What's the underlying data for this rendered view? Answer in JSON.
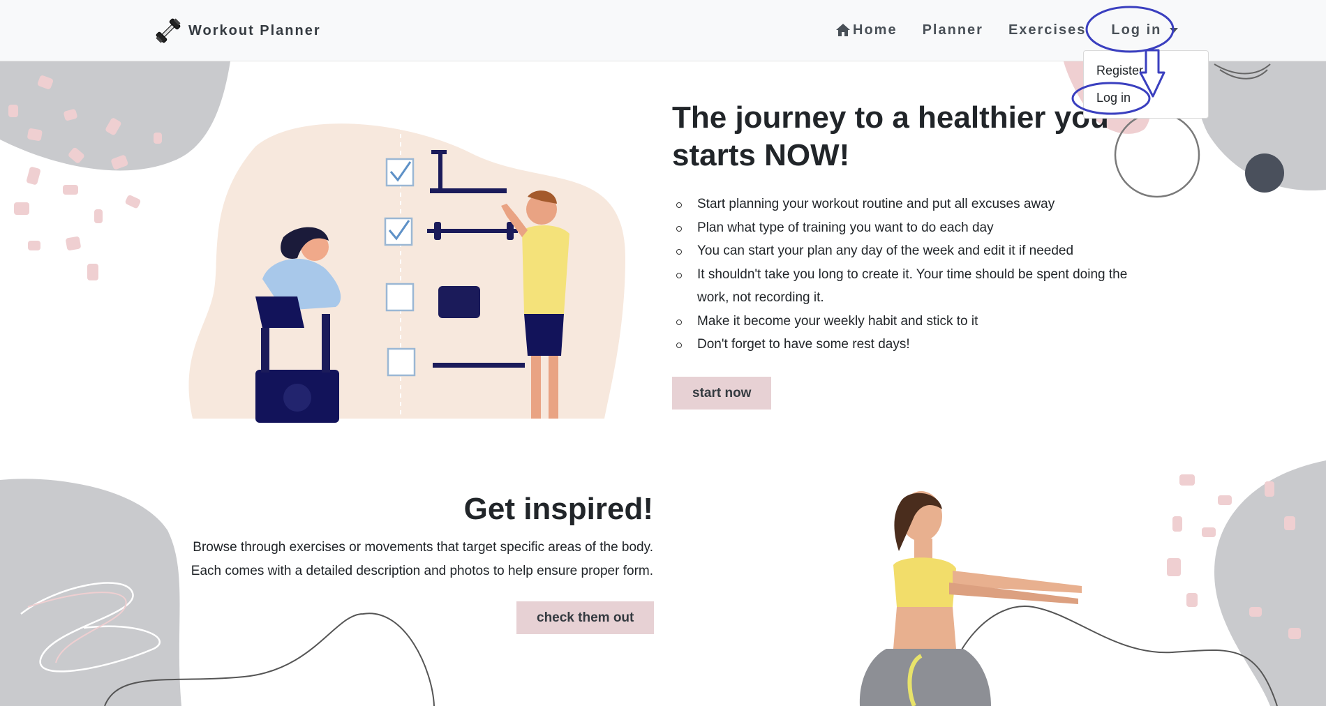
{
  "brand": {
    "name": "Workout Planner",
    "logo_icon": "dumbbell-icon"
  },
  "nav": {
    "home": "Home",
    "home_icon": "home-icon",
    "planner": "Planner",
    "exercises": "Exercises",
    "login": "Log in"
  },
  "dropdown": {
    "register": "Register",
    "login": "Log in"
  },
  "hero": {
    "title": "The journey to a healthier you starts NOW!",
    "items": [
      "Start planning your workout routine and put all excuses away",
      "Plan what type of training you want to do each day",
      "You can start your plan any day of the week and edit it if needed",
      "It shouldn't take you long to create it. Your time should be spent doing the work, not recording it.",
      "Make it become your weekly habit and stick to it",
      "Don't forget to have some rest days!"
    ],
    "button": "start now"
  },
  "inspired": {
    "title": "Get inspired!",
    "line1": "Browse through exercises or movements that target specific areas of the body.",
    "line2": "Each comes with a detailed description and photos to help ensure proper form.",
    "button": "check them out"
  },
  "colors": {
    "accent_button": "#e7d1d4",
    "annotation": "#3a3fbf",
    "deco_gray": "#c9cacd",
    "deco_pink": "#efcfd1"
  }
}
